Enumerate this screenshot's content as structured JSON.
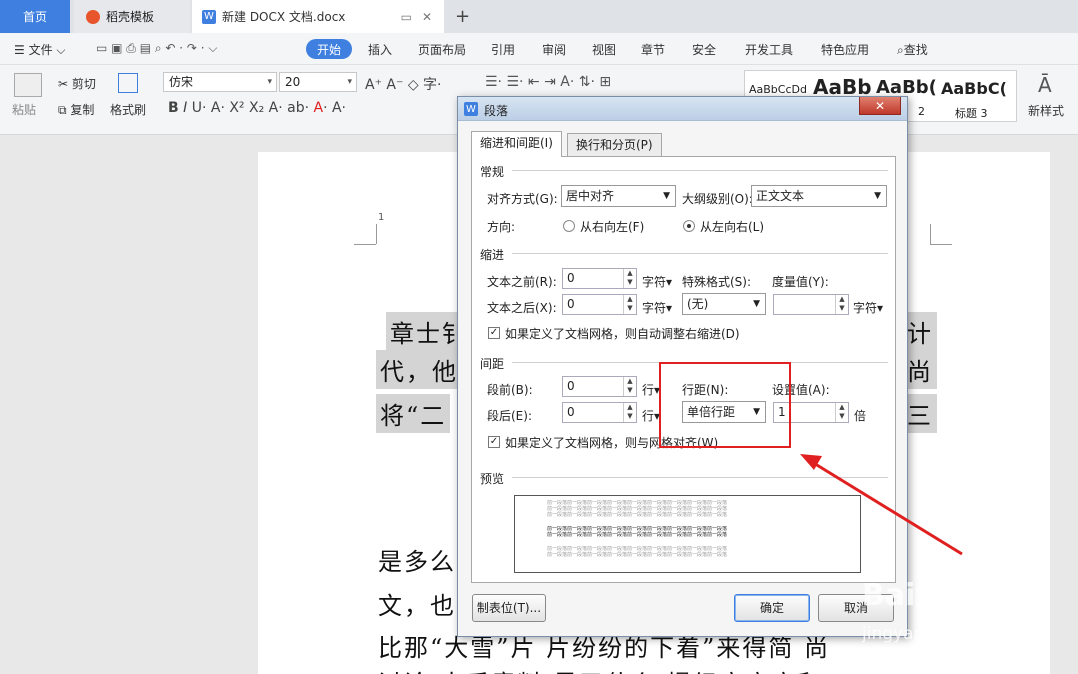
{
  "tabs": {
    "home": "首页",
    "daoke": "稻壳模板",
    "doc": "新建 DOCX 文档.docx"
  },
  "menu": {
    "file": "文件",
    "start": "开始",
    "insert": "插入",
    "layout": "页面布局",
    "ref": "引用",
    "review": "审阅",
    "view": "视图",
    "section": "章节",
    "security": "安全",
    "dev": "开发工具",
    "special": "特色应用",
    "search": "查找"
  },
  "ribbon": {
    "paste": "粘贴",
    "cut": "剪切",
    "copy": "复制",
    "painter": "格式刷",
    "font": "仿宋",
    "size": "20",
    "styles": [
      "AaBbCcDd",
      "AaBb",
      "AaBb(",
      "AaBbC("
    ],
    "style_labels": [
      "2",
      "标题 3"
    ],
    "new_style": "新样式"
  },
  "document": {
    "page_num": "1",
    "lines": [
      "章士钊",
      "代，他",
      "将“二",
      "是多么",
      "文，也",
      "比那“大雪”片 片纷纷的下着”来得简 尚",
      "讨论 出乎意料 是了什么 提织广广广和 ... "
    ],
    "right": [
      "计",
      "尚",
      "三"
    ]
  },
  "dialog": {
    "title": "段落",
    "tab_indent": "缩进和间距(I)",
    "tab_break": "换行和分页(P)",
    "general": "常规",
    "align_label": "对齐方式(G):",
    "align_value": "居中对齐",
    "outline_label": "大纲级别(O):",
    "outline_value": "正文文本",
    "dir_label": "方向:",
    "dir_rtl": "从右向左(F)",
    "dir_ltr": "从左向右(L)",
    "indent": "缩进",
    "before_text_label": "文本之前(R):",
    "before_text": "0",
    "unit_char": "字符",
    "after_text_label": "文本之后(X):",
    "after_text": "0",
    "special_label": "特殊格式(S):",
    "special_value": "(无)",
    "measure_label": "度量值(Y):",
    "measure_value": "",
    "grid_indent": "如果定义了文档网格，则自动调整右缩进(D)",
    "spacing": "间距",
    "before_label": "段前(B):",
    "before_value": "0",
    "unit_line": "行",
    "after_label": "段后(E):",
    "after_value": "0",
    "linesp_label": "行距(N):",
    "linesp_value": "单倍行距",
    "setval_label": "设置值(A):",
    "setval_value": "1",
    "unit_times": "倍",
    "grid_align": "如果定义了文档网格，则与网格对齐(W)",
    "preview": "预览",
    "preview_line": "前一段落前一段落前一段落前一段落前一段落前一段落前一段落前一段落前一段落",
    "tabstop": "制表位(T)...",
    "ok": "确定",
    "cancel": "取消"
  },
  "watermark": {
    "main": "Bai经验",
    "sub": "jingyan.baidu.com"
  },
  "colors": {
    "accent": "#3e7fe0",
    "annotation": "#e02020"
  }
}
